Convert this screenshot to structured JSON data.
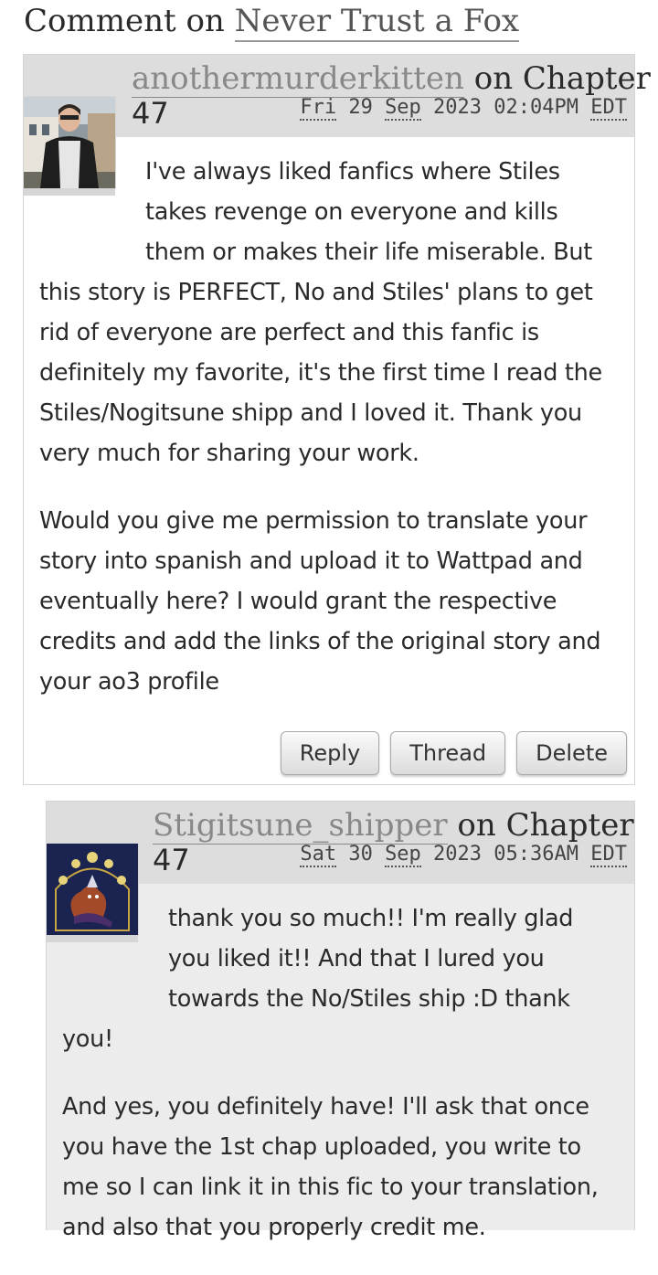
{
  "heading": {
    "prefix": "Comment on ",
    "work_title": "Never Trust a Fox"
  },
  "comments": [
    {
      "username": "anothermurderkitten",
      "on_text": " on Chapter",
      "chapter": "47",
      "date": {
        "day": "Fri",
        "date": " 29 ",
        "month": "Sep",
        "rest": " 2023 02:04PM ",
        "tz": "EDT"
      },
      "paragraphs": [
        "I've always liked fanfics where Stiles takes revenge on everyone and kills them or makes their life miserable. But this story is PERFECT, No and Stiles' plans to get rid of everyone are perfect and this fanfic is definitely my favorite, it's the first time I read the Stiles/Nogitsune shipp and I loved it. Thank you very much for sharing your work.",
        "Would you give me permission to translate your story into spanish and upload it to Wattpad and eventually here? I would grant the respective credits and add the links of the original story and your ao3 profile"
      ],
      "actions": [
        "Reply",
        "Thread",
        "Delete"
      ]
    },
    {
      "username": "Stigitsune_shipper",
      "on_text": " on Chapter",
      "chapter": "47",
      "date": {
        "day": "Sat",
        "date": " 30 ",
        "month": "Sep",
        "rest": " 2023 05:36AM ",
        "tz": "EDT"
      },
      "paragraphs": [
        "thank you so much!! I'm really glad you liked it!! And that I lured you towards the No/Stiles ship :D thank you!",
        "And yes, you definitely have! I'll ask that once you have the 1st chap uploaded, you write to me so I can link it in this fic to your translation, and also that you properly credit me."
      ]
    }
  ],
  "colors": {
    "header_bar": "#dddddd",
    "reply_background": "#ececec",
    "link_muted": "#888888"
  }
}
